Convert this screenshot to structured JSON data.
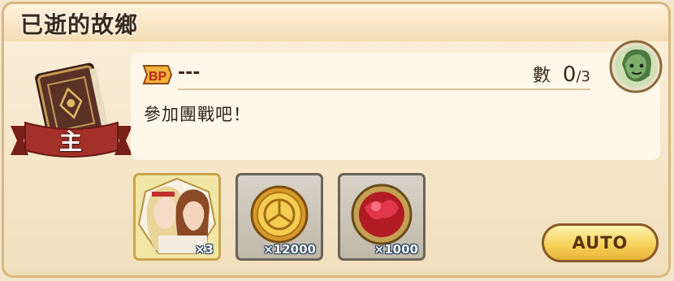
{
  "title": "已逝的故鄉",
  "badge": {
    "label": "主"
  },
  "bp": {
    "icon": "bp-icon",
    "label": "BP",
    "value": "---"
  },
  "count": {
    "label": "數",
    "current": "0",
    "max": "/3"
  },
  "description": "參加團戰吧！",
  "avatar": {
    "icon": "green-character-icon"
  },
  "rewards": [
    {
      "name": "characters-portrait",
      "quantity": "×3"
    },
    {
      "name": "gold-coin",
      "quantity": "×12000"
    },
    {
      "name": "red-orb",
      "quantity": "×1000"
    }
  ],
  "auto_button": {
    "label": "AUTO"
  },
  "colors": {
    "panel": "#f6e8cc",
    "accent": "#f6cf55",
    "ribbon": "#9b2b22",
    "text": "#3a2a1c"
  }
}
